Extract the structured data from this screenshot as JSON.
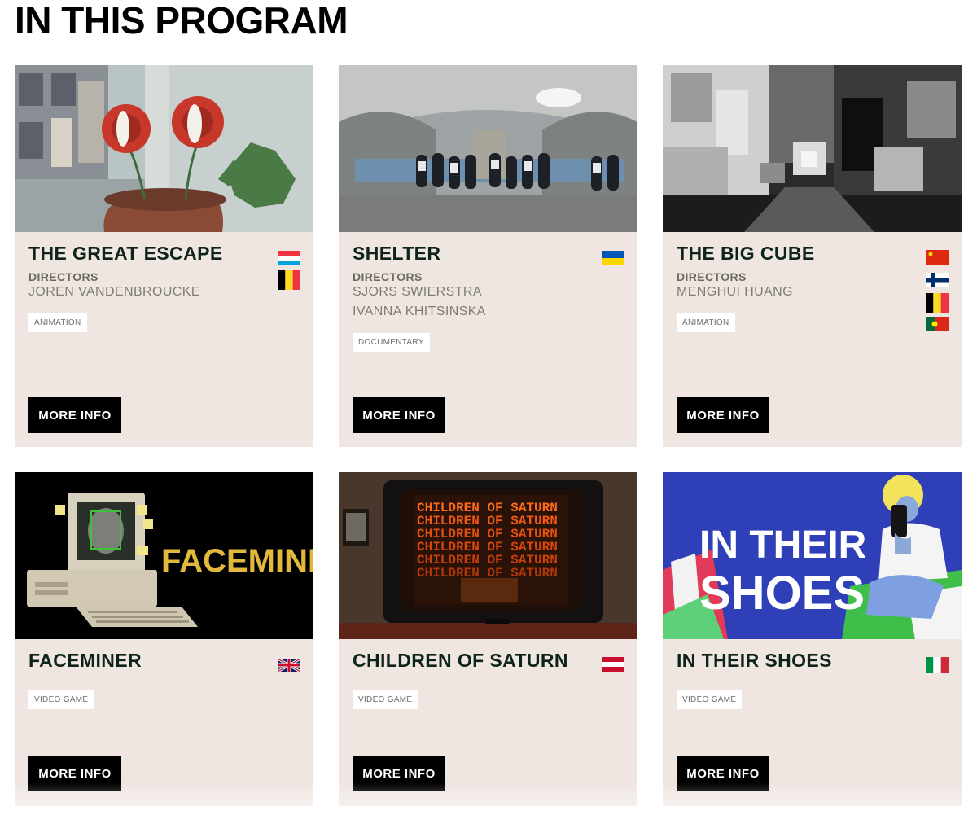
{
  "page": {
    "title": "IN THIS PROGRAM"
  },
  "cards": [
    {
      "title": "THE GREAT ESCAPE",
      "directors_label": "DIRECTORS",
      "directors": [
        "JOREN VANDENBROUCKE"
      ],
      "tag": "ANIMATION",
      "button": "MORE INFO",
      "flags": [
        "luxembourg",
        "belgium"
      ]
    },
    {
      "title": "SHELTER",
      "directors_label": "DIRECTORS",
      "directors": [
        "SJORS SWIERSTRA",
        "IVANNA KHITSINSKA"
      ],
      "tag": "DOCUMENTARY",
      "button": "MORE INFO",
      "flags": [
        "ukraine"
      ]
    },
    {
      "title": "THE BIG CUBE",
      "directors_label": "DIRECTORS",
      "directors": [
        "MENGHUI HUANG"
      ],
      "tag": "ANIMATION",
      "button": "MORE INFO",
      "flags": [
        "china",
        "finland",
        "belgium",
        "portugal"
      ]
    },
    {
      "title": "FACEMINER",
      "tag": "VIDEO GAME",
      "button": "MORE INFO",
      "flags": [
        "united-kingdom"
      ],
      "image_text": "FACEMINER"
    },
    {
      "title": "CHILDREN OF SATURN",
      "tag": "VIDEO GAME",
      "button": "MORE INFO",
      "flags": [
        "austria"
      ],
      "image_text": "CHILDREN OF SATURN"
    },
    {
      "title": "IN THEIR SHOES",
      "tag": "VIDEO GAME",
      "button": "MORE INFO",
      "flags": [
        "italy"
      ],
      "image_text": [
        "IN THEIR",
        "SHOES"
      ]
    }
  ],
  "colors": {
    "card_bg": "#efe6e2",
    "title": "#0f2418",
    "button_bg": "#000000",
    "button_text": "#ffffff"
  }
}
